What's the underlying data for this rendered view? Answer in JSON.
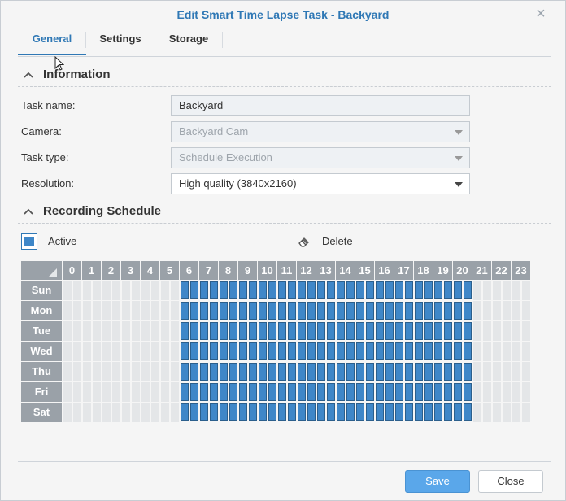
{
  "dialog": {
    "title": "Edit Smart Time Lapse Task - Backyard",
    "tabs": [
      {
        "label": "General",
        "active": true
      },
      {
        "label": "Settings",
        "active": false
      },
      {
        "label": "Storage",
        "active": false
      }
    ],
    "information": {
      "section_title": "Information",
      "fields": {
        "task_name": {
          "label": "Task name:",
          "value": "Backyard"
        },
        "camera": {
          "label": "Camera:",
          "value": "Backyard Cam"
        },
        "task_type": {
          "label": "Task type:",
          "value": "Schedule Execution"
        },
        "resolution": {
          "label": "Resolution:",
          "value": "High quality (3840x2160)"
        }
      }
    },
    "recording_schedule": {
      "section_title": "Recording Schedule",
      "active_label": "Active",
      "delete_label": "Delete",
      "hours": [
        "0",
        "1",
        "2",
        "3",
        "4",
        "5",
        "6",
        "7",
        "8",
        "9",
        "10",
        "11",
        "12",
        "13",
        "14",
        "15",
        "16",
        "17",
        "18",
        "19",
        "20",
        "21",
        "22",
        "23"
      ],
      "days": [
        "Sun",
        "Mon",
        "Tue",
        "Wed",
        "Thu",
        "Fri",
        "Sat"
      ],
      "active_hours": [
        6,
        7,
        8,
        9,
        10,
        11,
        12,
        13,
        14,
        15,
        16,
        17,
        18,
        19,
        20
      ]
    },
    "buttons": {
      "save": "Save",
      "close": "Close"
    }
  },
  "colors": {
    "accent": "#2f78b5",
    "schedule_active": "#3f87c8",
    "grid_header": "#9aa1a8",
    "cell_inactive": "#e4e6e8"
  }
}
